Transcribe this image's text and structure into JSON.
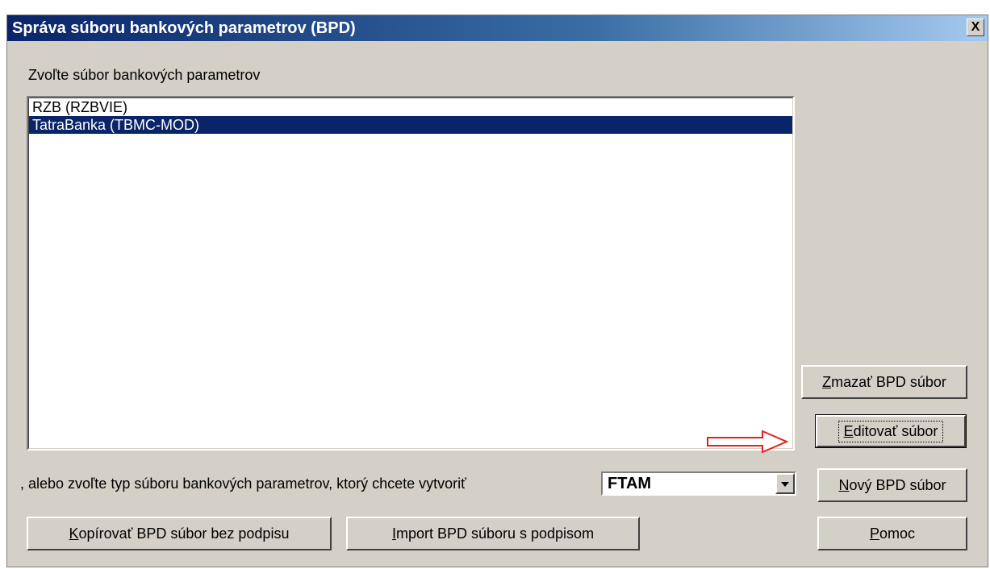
{
  "window": {
    "title": "Správa súboru bankových parametrov (BPD)",
    "close_label": "X"
  },
  "list": {
    "label": "Zvoľte súbor bankových parametrov",
    "items": [
      {
        "label": "RZB (RZBVIE)",
        "selected": false
      },
      {
        "label": "TatraBanka (TBMC-MOD)",
        "selected": true
      }
    ]
  },
  "type_selector": {
    "label": ", alebo zvoľte typ súboru bankových parametrov, ktorý chcete vytvoriť",
    "value": "FTAM"
  },
  "buttons": {
    "delete": {
      "mnemonic": "Z",
      "rest": "mazať BPD súbor"
    },
    "edit": {
      "mnemonic": "E",
      "rest": "ditovať súbor"
    },
    "new": {
      "mnemonic": "N",
      "rest": "ový BPD súbor"
    },
    "help": {
      "mnemonic": "P",
      "rest": "omoc"
    },
    "copy": {
      "mnemonic": "K",
      "rest": "opírovať BPD súbor bez podpisu"
    },
    "import": {
      "mnemonic": "I",
      "rest": "mport BPD súboru s podpisom"
    }
  },
  "colors": {
    "accent_arrow": "#e02020",
    "selection": "#0a246a"
  },
  "icons": {
    "close": "close-icon",
    "dropdown": "chevron-down-icon",
    "annotation": "arrow-right-icon"
  }
}
